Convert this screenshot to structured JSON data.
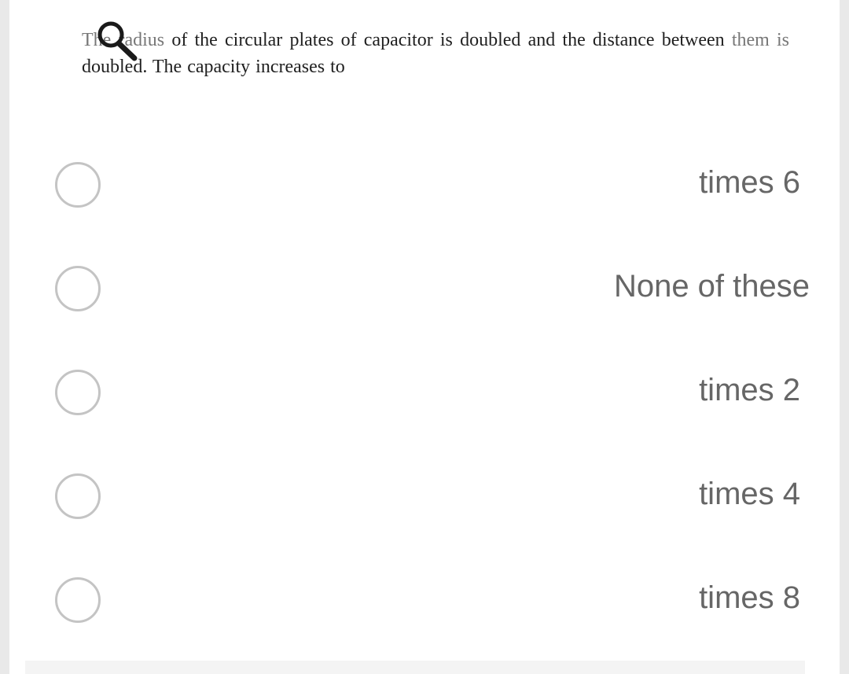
{
  "question": {
    "part_faded_1": "The",
    "part_faded_2": " radius",
    "part_main_1": " of the circular plates of capacitor is doubled and the distance between ",
    "part_faded_3": "them is",
    "part_main_2": " doubled. The capacity increases to"
  },
  "options": [
    {
      "label": "times 6"
    },
    {
      "label": "None of these"
    },
    {
      "label": "times 2"
    },
    {
      "label": "times 4"
    },
    {
      "label": "times 8"
    }
  ],
  "icons": {
    "magnifier": "magnifying-glass-icon",
    "radio": "radio-circle-icon"
  },
  "colors": {
    "option_text": "#666666",
    "radio_border": "#c4c4c4",
    "question_text": "#1f1f1f"
  }
}
